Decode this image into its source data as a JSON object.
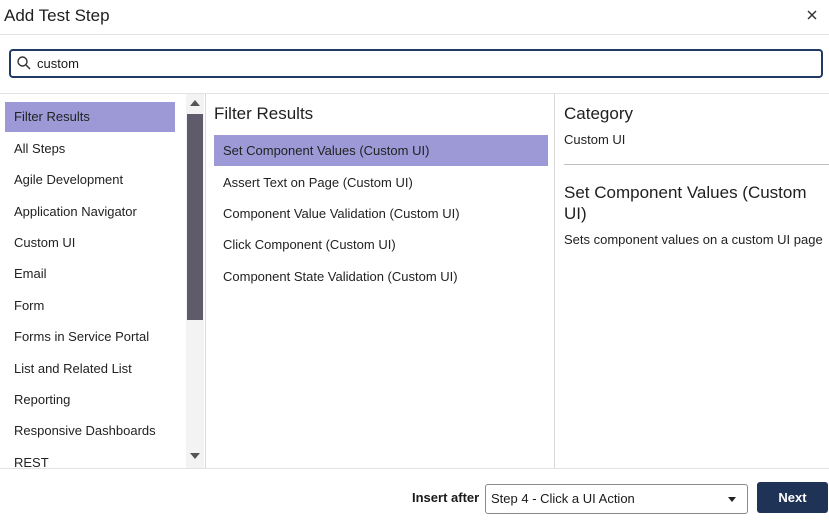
{
  "dialog": {
    "title": "Add Test Step",
    "close_icon": "close-icon"
  },
  "search": {
    "value": "custom",
    "icon": "search-icon"
  },
  "categories": {
    "selected_index": 0,
    "items": [
      "Filter Results",
      "All Steps",
      "Agile Development",
      "Application Navigator",
      "Custom UI",
      "Email",
      "Form",
      "Forms in Service Portal",
      "List and Related List",
      "Reporting",
      "Responsive Dashboards",
      "REST"
    ]
  },
  "results": {
    "title": "Filter Results",
    "selected_index": 0,
    "items": [
      "Set Component Values (Custom UI)",
      "Assert Text on Page (Custom UI)",
      "Component Value Validation (Custom UI)",
      "Click Component (Custom UI)",
      "Component State Validation (Custom UI)"
    ]
  },
  "detail": {
    "category_heading": "Category",
    "category_value": "Custom UI",
    "step_name": "Set Component Values (Custom UI)",
    "step_description": "Sets component values on a custom UI page"
  },
  "footer": {
    "insert_after_label": "Insert after",
    "insert_after_value": "Step 4 - Click a UI Action",
    "next_label": "Next"
  },
  "colors": {
    "selection": "#9c99d6",
    "primary_button": "#1f3356",
    "search_border": "#1f3b63",
    "scroll_thumb": "#5f5b6b"
  }
}
